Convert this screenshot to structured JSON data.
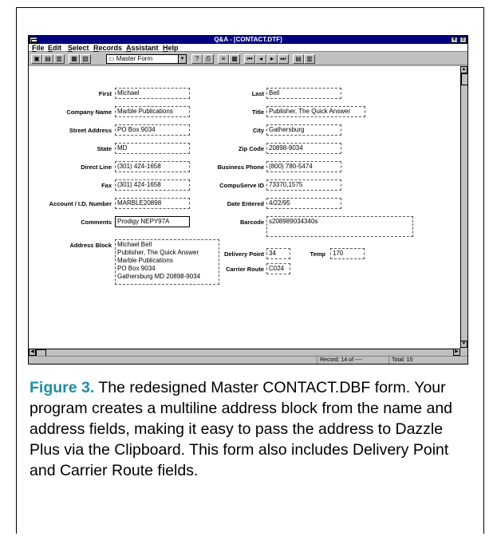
{
  "window": {
    "title": "Q&A - [CONTACT.DTF]",
    "min_glyph": "▼",
    "max_glyph": "⇕"
  },
  "menu": [
    "File",
    "Edit",
    "Select",
    "Records",
    "Assistant",
    "Help"
  ],
  "toolbar": {
    "form_select_value": "Master Form",
    "form_select_arrow": "▼"
  },
  "form": {
    "fields": [
      {
        "label": "First",
        "value": "Michael"
      },
      {
        "label": "Last",
        "value": "Bell"
      },
      {
        "label": "Company Name",
        "value": "Marble Publications"
      },
      {
        "label": "Title",
        "value": "Publisher, The Quick Answer"
      },
      {
        "label": "Street Address",
        "value": "PO Box 9034"
      },
      {
        "label": "City",
        "value": "Gathersburg"
      },
      {
        "label": "State",
        "value": "MD"
      },
      {
        "label": "Zip Code",
        "value": "20898-9034"
      },
      {
        "label": "Direct Line",
        "value": "(301) 424-1658"
      },
      {
        "label": "Business Phone",
        "value": "(800) 780-5474"
      },
      {
        "label": "Fax",
        "value": "(301) 424-1658"
      },
      {
        "label": "CompuServe ID",
        "value": "73370,1575"
      },
      {
        "label": "Account / I.D. Number",
        "value": "MARBLE20898"
      },
      {
        "label": "Date Entered",
        "value": "4/22/95"
      },
      {
        "label": "Comments",
        "value": "Prodigy NEPY97A"
      },
      {
        "label": "Barcode",
        "value": "s208989034340s"
      },
      {
        "label": "Address Block",
        "value": "Michael Bell\nPublisher, The Quick Answer\nMarble Publications\nPO Box 9034\nGathersburg MD 20898-9034"
      },
      {
        "label": "Delivery Point",
        "value": "34"
      },
      {
        "label": "Temp",
        "value": "170"
      },
      {
        "label": "Carrier Route",
        "value": "C024"
      }
    ]
  },
  "status": {
    "record": "Record: 14 of ----",
    "total": "Total: 15"
  },
  "caption": {
    "label": "Figure 3.",
    "text": " The redesigned Master CONTACT.DBF form. Your program creates a multiline address block from the name and address fields, making it easy to pass the address to Dazzle Plus via the Clipboard. This form also includes Delivery Point and Carrier Route fields."
  }
}
